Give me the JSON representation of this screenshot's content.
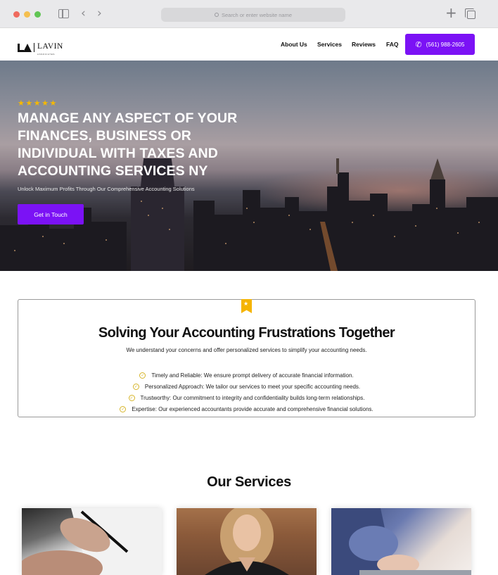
{
  "browser": {
    "url_placeholder": "Search or enter website name"
  },
  "header": {
    "logo_text": "LAVIN",
    "logo_subtext": "ASSOCIATES",
    "nav": [
      "About Us",
      "Services",
      "Reviews",
      "FAQ"
    ],
    "phone": "(561) 988-2605"
  },
  "hero": {
    "stars": "★★★★★",
    "rating": 5,
    "title": "Manage any aspect of your finances, business or individual with taxes and accounting services NY",
    "subtitle": "Unlock Maximum Profits Through Our Comprehensive Accounting Solutions",
    "cta": "Get in Touch"
  },
  "frustrations": {
    "title": "Solving Your Accounting Frustrations Together",
    "subtitle": "We understand your concerns and offer personalized services to simplify your accounting needs.",
    "features": [
      "Timely and Reliable: We ensure prompt delivery of accurate financial information.",
      "Personalized Approach: We tailor our services to meet your specific accounting needs.",
      "Trustworthy: Our commitment to integrity and confidentiality builds long-term relationships.",
      "Expertise: Our experienced accountants provide accurate and comprehensive financial solutions."
    ]
  },
  "services": {
    "title": "Our Services"
  },
  "colors": {
    "accent": "#7b12f5",
    "star": "#f5b800",
    "check": "#d6b52a"
  }
}
